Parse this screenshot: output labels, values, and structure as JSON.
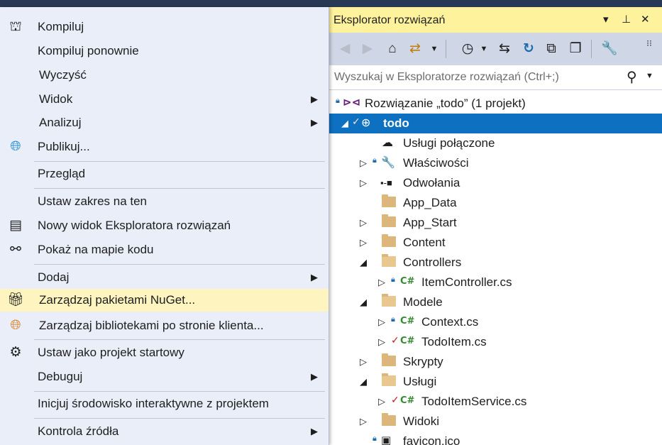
{
  "explorer": {
    "title": "Eksplorator rozwiązań",
    "title_buttons": [
      "▾",
      "⊥",
      "✕"
    ],
    "search_placeholder": "Wyszukaj w Eksploratorze rozwiązań (Ctrl+;)",
    "tree": [
      {
        "label": "Rozwiązanie „todo” (1 projekt)"
      },
      {
        "label": "todo"
      },
      {
        "label": "Usługi połączone"
      },
      {
        "label": "Właściwości"
      },
      {
        "label": "Odwołania"
      },
      {
        "label": "App_Data"
      },
      {
        "label": "App_Start"
      },
      {
        "label": "Content"
      },
      {
        "label": "Controllers"
      },
      {
        "label": "ItemController.cs"
      },
      {
        "label": "Modele"
      },
      {
        "label": "Context.cs"
      },
      {
        "label": "TodoItem.cs"
      },
      {
        "label": "Skrypty"
      },
      {
        "label": "Usługi"
      },
      {
        "label": "TodoItemService.cs"
      },
      {
        "label": "Widoki"
      },
      {
        "label": "favicon.ico"
      }
    ]
  },
  "menu": {
    "items": [
      {
        "label": "Kompiluj"
      },
      {
        "label": "Kompiluj ponownie"
      },
      {
        "label": "Wyczyść"
      },
      {
        "label": "Widok"
      },
      {
        "label": "Analizuj"
      },
      {
        "label": "Publikuj..."
      },
      {
        "label": "Przegląd"
      },
      {
        "label": "Ustaw zakres na ten"
      },
      {
        "label": "Nowy widok Eksploratora rozwiązań"
      },
      {
        "label": "Pokaż na mapie kodu"
      },
      {
        "label": "Dodaj"
      },
      {
        "label": "Zarządzaj pakietami NuGet..."
      },
      {
        "label": "Zarządzaj bibliotekami po stronie klienta..."
      },
      {
        "label": "Ustaw jako projekt startowy"
      },
      {
        "label": "Debuguj"
      },
      {
        "label": "Inicjuj środowisko interaktywne z projektem"
      },
      {
        "label": "Kontrola źródła"
      }
    ]
  },
  "colors": {
    "selection": "#0e70c0",
    "menu_hover": "#fdf4bf",
    "title_bar": "#fff29d",
    "toolbar": "#cfd6e5",
    "menu_bg": "#e9eef9",
    "frame": "#293955"
  }
}
